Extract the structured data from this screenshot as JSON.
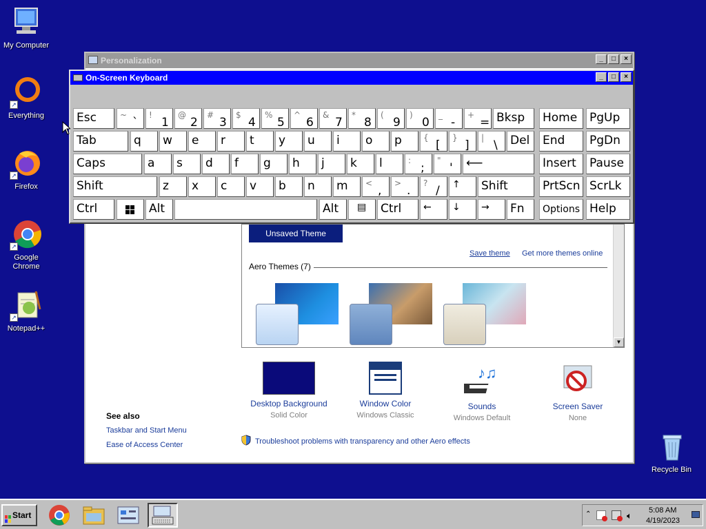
{
  "desktop": {
    "icons": [
      {
        "label": "My Computer"
      },
      {
        "label": "Everything"
      },
      {
        "label": "Firefox"
      },
      {
        "label": "Google Chrome"
      },
      {
        "label": "Notepad++"
      },
      {
        "label": "Recycle Bin"
      }
    ]
  },
  "personalization": {
    "title": "Personalization",
    "unsaved_theme": "Unsaved Theme",
    "save_theme": "Save theme",
    "more_themes": "Get more themes online",
    "aero_header": "Aero Themes (7)",
    "items": [
      {
        "name": "Desktop Background",
        "sub": "Solid Color"
      },
      {
        "name": "Window Color",
        "sub": "Windows Classic"
      },
      {
        "name": "Sounds",
        "sub": "Windows Default"
      },
      {
        "name": "Screen Saver",
        "sub": "None"
      }
    ],
    "see_also": "See also",
    "see_also_links": [
      "Taskbar and Start Menu",
      "Ease of Access Center"
    ],
    "troubleshoot": "Troubleshoot problems with transparency and other Aero effects"
  },
  "osk": {
    "title": "On-Screen Keyboard",
    "keys": {
      "esc": "Esc",
      "bksp": "Bksp",
      "home": "Home",
      "pgup": "PgUp",
      "tab": "Tab",
      "del": "Del",
      "end": "End",
      "pgdn": "PgDn",
      "caps": "Caps",
      "enter": "⟵",
      "insert": "Insert",
      "pause": "Pause",
      "shift": "Shift",
      "up": "↑",
      "rshift": "Shift",
      "prtscn": "PrtScn",
      "scrlk": "ScrLk",
      "ctrl": "Ctrl",
      "alt": "Alt",
      "ralt": "Alt",
      "menu": "▤",
      "rctrl": "Ctrl",
      "left": "←",
      "down": "↓",
      "right": "→",
      "fn": "Fn",
      "options": "Options",
      "help": "Help",
      "q": "q",
      "w": "w",
      "e": "e",
      "r": "r",
      "t": "t",
      "y": "y",
      "u": "u",
      "i": "i",
      "o": "o",
      "p": "p",
      "a": "a",
      "s": "s",
      "d": "d",
      "f": "f",
      "g": "g",
      "h": "h",
      "j": "j",
      "k": "k",
      "l": "l",
      "z": "z",
      "x": "x",
      "c": "c",
      "v": "v",
      "b": "b",
      "n": "n",
      "m": "m"
    },
    "sym_keys": [
      {
        "hi": "~",
        "lo": "`"
      },
      {
        "hi": "!",
        "lo": "1"
      },
      {
        "hi": "@",
        "lo": "2"
      },
      {
        "hi": "#",
        "lo": "3"
      },
      {
        "hi": "$",
        "lo": "4"
      },
      {
        "hi": "%",
        "lo": "5"
      },
      {
        "hi": "^",
        "lo": "6"
      },
      {
        "hi": "&",
        "lo": "7"
      },
      {
        "hi": "*",
        "lo": "8"
      },
      {
        "hi": "(",
        "lo": "9"
      },
      {
        "hi": ")",
        "lo": "0"
      },
      {
        "hi": "_",
        "lo": "-"
      },
      {
        "hi": "+",
        "lo": "="
      },
      {
        "hi": "{",
        "lo": "["
      },
      {
        "hi": "}",
        "lo": "]"
      },
      {
        "hi": "|",
        "lo": "\\"
      },
      {
        "hi": ":",
        "lo": ";"
      },
      {
        "hi": "\"",
        "lo": "'"
      },
      {
        "hi": "<",
        "lo": ","
      },
      {
        "hi": ">",
        "lo": "."
      },
      {
        "hi": "?",
        "lo": "/"
      }
    ]
  },
  "taskbar": {
    "start": "Start",
    "time": "5:08 AM",
    "date": "4/19/2023"
  },
  "colors": {
    "desktop": "#0e0f8f",
    "osk_title": "#0000ff",
    "link": "#1a3c9a"
  }
}
